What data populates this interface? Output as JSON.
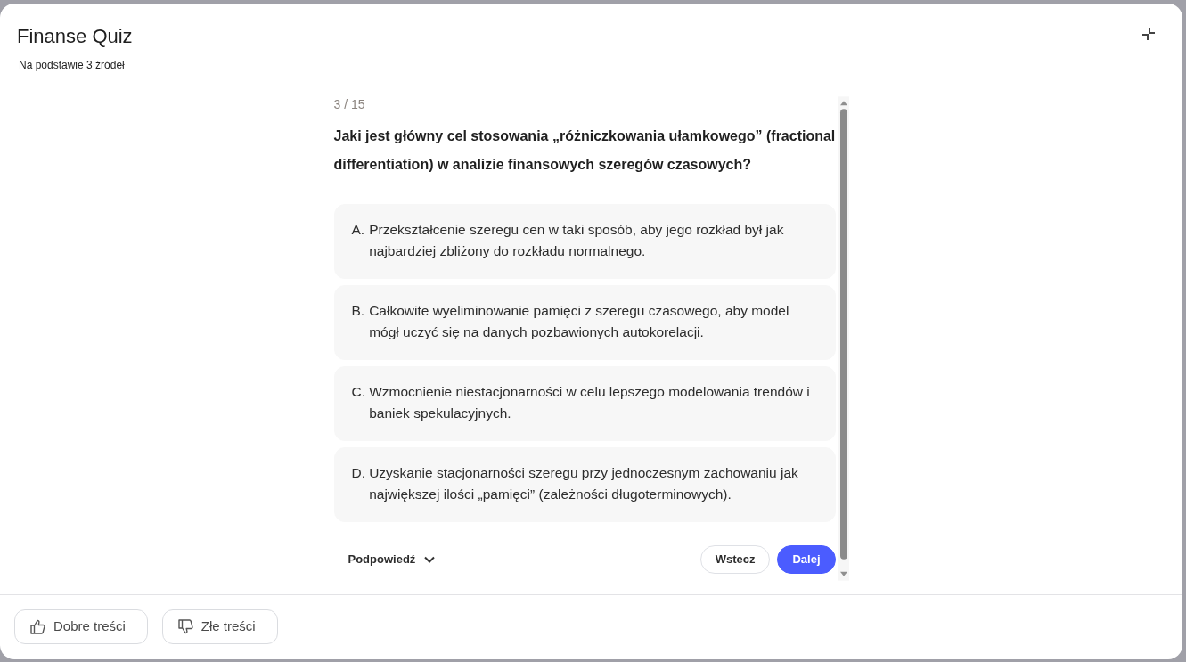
{
  "dialog": {
    "title": "Finanse Quiz",
    "subtitle": "Na podstawie 3 źródeł"
  },
  "quiz": {
    "progress": "3 / 15",
    "question": "Jaki jest główny cel stosowania „różniczkowania ułamkowego” (fractional differentiation) w analizie finansowych szeregów czasowych?",
    "options": [
      {
        "letter": "A.",
        "text": "Przekształcenie szeregu cen w taki sposób, aby jego rozkład był jak najbardziej zbliżony do rozkładu normalnego.",
        "selected": false
      },
      {
        "letter": "B.",
        "text": "Całkowite wyeliminowanie pamięci z szeregu czasowego, aby model mógł uczyć się na danych pozbawionych autokorelacji.",
        "selected": false
      },
      {
        "letter": "C.",
        "text": "Wzmocnienie niestacjonarności w celu lepszego modelowania trendów i baniek spekulacyjnych.",
        "selected": false
      },
      {
        "letter": "D.",
        "text": "Uzyskanie stacjonarności szeregu przy jednoczesnym zachowaniu jak największej ilości „pamięci” (zależności długoterminowych).",
        "selected": false
      }
    ],
    "hint": {
      "label": "Podpowiedź",
      "expanded": false
    },
    "buttons": [
      {
        "label": "Wstecz",
        "kind": "secondary"
      },
      {
        "label": "Dalej",
        "kind": "primary"
      }
    ]
  },
  "feedback": [
    {
      "label": "Dobre treści",
      "kind": "thumbs-up"
    },
    {
      "label": "Złe treści",
      "kind": "thumbs-down"
    }
  ]
}
